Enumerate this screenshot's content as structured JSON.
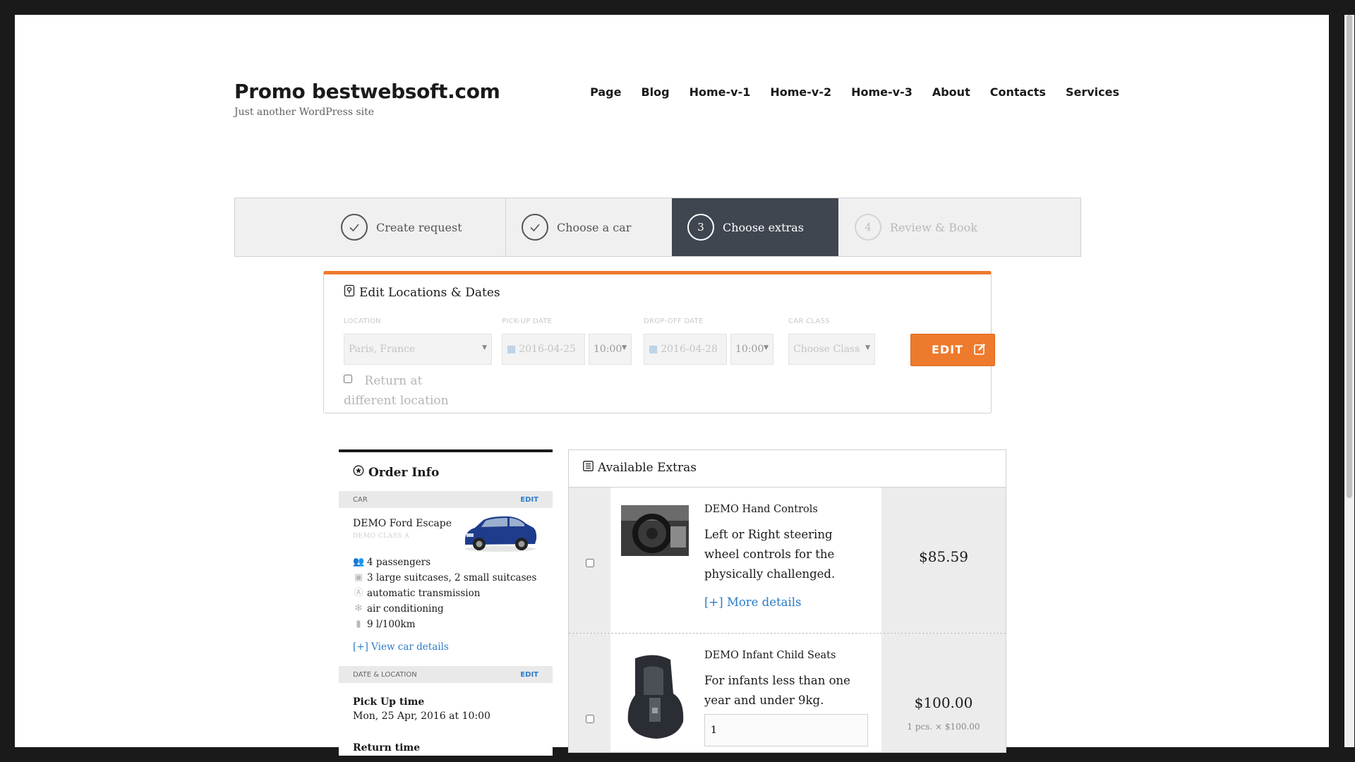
{
  "site": {
    "title": "Promo bestwebsoft.com",
    "description": "Just another WordPress site"
  },
  "nav": {
    "items": [
      "Page",
      "Blog",
      "Home-v-1",
      "Home-v-2",
      "Home-v-3",
      "About",
      "Contacts",
      "Services"
    ]
  },
  "steps": [
    {
      "label": "Create request",
      "state": "done"
    },
    {
      "label": "Choose a car",
      "state": "done"
    },
    {
      "number": "3",
      "label": "Choose extras",
      "state": "active"
    },
    {
      "number": "4",
      "label": "Review & Book",
      "state": "pending"
    }
  ],
  "edit_panel": {
    "title": "Edit Locations & Dates",
    "location_label": "LOCATION",
    "location_value": "Paris, France",
    "pickup_label": "PICK-UP DATE",
    "pickup_date": "2016-04-25",
    "pickup_time": "10:00",
    "dropoff_label": "DROP-OFF DATE",
    "dropoff_date": "2016-04-28",
    "dropoff_time": "10:00",
    "class_label": "CAR CLASS",
    "class_placeholder": "Choose Class",
    "edit_button": "EDIT",
    "return_label": "Return at different location"
  },
  "order_info": {
    "title": "Order Info",
    "car_bar": "CAR",
    "edit_link": "EDIT",
    "car_name": "DEMO Ford Escape",
    "car_class": "DEMO CLASS A",
    "features": [
      {
        "icon": "passengers-icon",
        "text": "4 passengers"
      },
      {
        "icon": "suitcase-icon",
        "text": "3 large suitcases, 2 small suitcases"
      },
      {
        "icon": "transmission-icon",
        "text": "automatic transmission"
      },
      {
        "icon": "snowflake-icon",
        "text": "air conditioning"
      },
      {
        "icon": "fuel-icon",
        "text": "9 l/100km"
      }
    ],
    "view_details": "[+] View car details",
    "date_bar": "DATE & LOCATION",
    "pickup_label": "Pick Up time",
    "pickup_value": "Mon, 25 Apr, 2016 at 10:00",
    "return_label": "Return time"
  },
  "extras": {
    "title": "Available Extras",
    "items": [
      {
        "name": "DEMO Hand Controls",
        "description": "Left or Right steering wheel controls for the physically challenged.",
        "more": "[+] More details",
        "price": "$85.59"
      },
      {
        "name": "DEMO Infant Child Seats",
        "description": "For infants less than one year and under 9kg.",
        "quantity": "1",
        "price": "$100.00",
        "price_detail": "1 pcs. × $100.00"
      }
    ]
  },
  "colors": {
    "accent": "#ee7a2d",
    "active_step": "#3f4650",
    "link": "#2a7bc8"
  }
}
